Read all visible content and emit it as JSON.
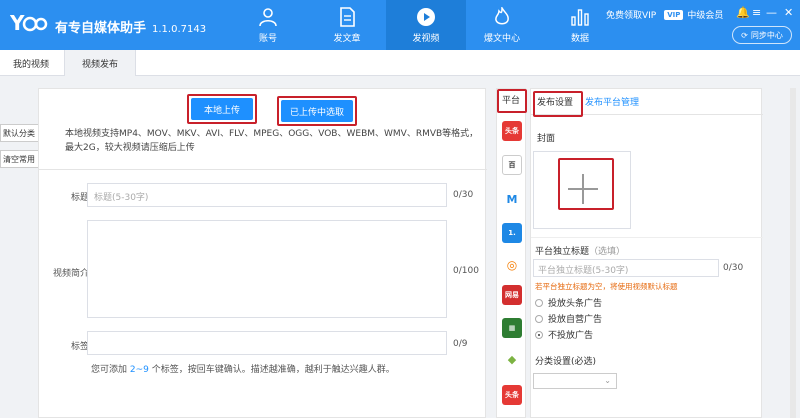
{
  "app": {
    "title": "有专自媒体助手",
    "version": "1.1.0.7143",
    "logo_text": "Y"
  },
  "nav": [
    {
      "label": "账号",
      "icon": "user-icon"
    },
    {
      "label": "发文章",
      "icon": "document-icon"
    },
    {
      "label": "发视频",
      "icon": "play-icon",
      "active": true
    },
    {
      "label": "爆文中心",
      "icon": "flame-icon"
    },
    {
      "label": "数据",
      "icon": "bar-chart-icon"
    }
  ],
  "header": {
    "free_vip": "免费领取VIP",
    "vip_badge": "VIP",
    "member_level": "中级会员",
    "sync_label": "同步中心",
    "bell": "🔔",
    "menu": "≡",
    "minimize": "—",
    "close": "✕"
  },
  "tabs": [
    "我的视频",
    "视频发布"
  ],
  "left_stub": {
    "default_category": "默认分类",
    "clear_common": "清空常用"
  },
  "upload": {
    "local_upload": "本地上传",
    "choose_uploaded": "已上传中选取",
    "support_text": "本地视频支持MP4、MOV、MKV、AVI、FLV、MPEG、OGG、VOB、WEBM、WMV、RMVB等格式，最大2G，较大视频请压缩后上传"
  },
  "form": {
    "title_label": "标题",
    "title_placeholder": "标题(5-30字)",
    "title_counter": "0/30",
    "intro_label": "视频简介",
    "intro_counter": "0/100",
    "tags_label": "标签",
    "tags_counter": "0/9",
    "tags_hint_prefix": "您可添加 ",
    "tags_hint_num": "2~9",
    "tags_hint_suffix": " 个标签，按回车键确认。描述越准确，越利于触达兴趣人群。"
  },
  "platforms": {
    "header": "平台",
    "icons": [
      {
        "name": "toutiao-icon",
        "text": "头条",
        "color": "#e53935"
      },
      {
        "name": "baijiahao-icon",
        "text": "百",
        "color": "#333333"
      },
      {
        "name": "m-icon",
        "text": "M",
        "color": "#1e88e5"
      },
      {
        "name": "yidian-icon",
        "text": "1.",
        "color": "#1e88e5"
      },
      {
        "name": "dayu-icon",
        "text": "◎",
        "color": "#f57c00"
      },
      {
        "name": "wangyi-icon",
        "text": "网易",
        "color": "#d32f2f"
      },
      {
        "name": "book-icon",
        "text": "▦",
        "color": "#2e7d32"
      },
      {
        "name": "diamond-icon",
        "text": "◆",
        "color": "#7cb342"
      },
      {
        "name": "toutiao2-icon",
        "text": "头条",
        "color": "#e53935"
      }
    ]
  },
  "right": {
    "tab_publish_settings": "发布设置",
    "tab_platform_manage": "发布平台管理",
    "cover_label": "封面",
    "platform_title_label": "平台独立标题",
    "platform_title_hint": "（选填）",
    "platform_title_placeholder": "平台独立标题(5-30字)",
    "platform_title_counter": "0/30",
    "warn": "若平台独立标题为空，将使用视频默认标题",
    "ad_options": [
      "投放头条广告",
      "投放自营广告",
      "不投放广告"
    ],
    "ad_selected": 2,
    "category_label": "分类设置(必选)",
    "category_chevron": "⌄"
  }
}
